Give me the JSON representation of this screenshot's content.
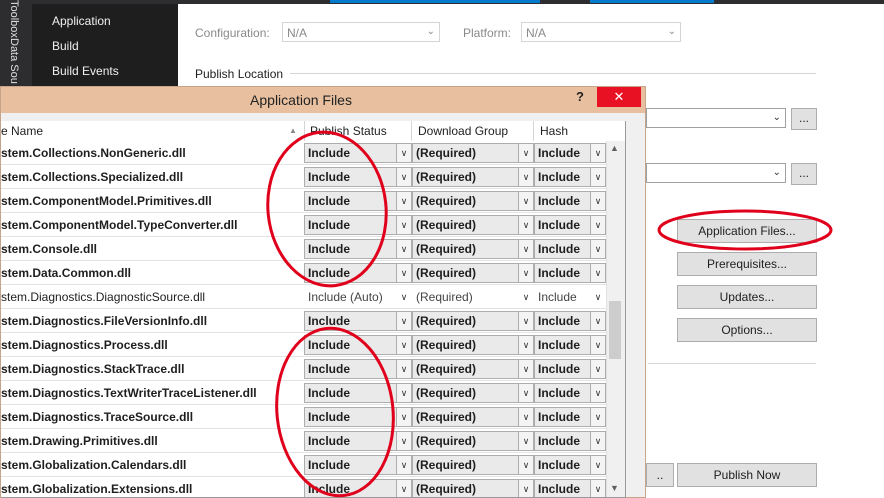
{
  "sidebar_tabs": [
    "Toolbox",
    "Data Sou"
  ],
  "project_nav": [
    "Application",
    "Build",
    "Build Events"
  ],
  "properties": {
    "configuration_label": "Configuration:",
    "configuration_value": "N/A",
    "platform_label": "Platform:",
    "platform_value": "N/A",
    "publish_location_label": "Publish Location",
    "browse_label": "...",
    "application_files_button": "Application Files...",
    "prerequisites_button": "Prerequisites...",
    "updates_button": "Updates...",
    "options_button": "Options...",
    "publish_now_button": "Publish Now"
  },
  "dialog": {
    "title": "Application Files",
    "help_label": "?",
    "close_label": "✕",
    "columns": [
      "e Name",
      "Publish Status",
      "Download Group",
      "Hash"
    ],
    "rows": [
      {
        "name": "stem.Collections.NonGeneric.dll",
        "status": "Include",
        "group": "(Required)",
        "hash": "Include",
        "auto": false
      },
      {
        "name": "stem.Collections.Specialized.dll",
        "status": "Include",
        "group": "(Required)",
        "hash": "Include",
        "auto": false
      },
      {
        "name": "stem.ComponentModel.Primitives.dll",
        "status": "Include",
        "group": "(Required)",
        "hash": "Include",
        "auto": false
      },
      {
        "name": "stem.ComponentModel.TypeConverter.dll",
        "status": "Include",
        "group": "(Required)",
        "hash": "Include",
        "auto": false
      },
      {
        "name": "stem.Console.dll",
        "status": "Include",
        "group": "(Required)",
        "hash": "Include",
        "auto": false
      },
      {
        "name": "stem.Data.Common.dll",
        "status": "Include",
        "group": "(Required)",
        "hash": "Include",
        "auto": false
      },
      {
        "name": "stem.Diagnostics.DiagnosticSource.dll",
        "status": "Include (Auto)",
        "group": "(Required)",
        "hash": "Include",
        "auto": true
      },
      {
        "name": "stem.Diagnostics.FileVersionInfo.dll",
        "status": "Include",
        "group": "(Required)",
        "hash": "Include",
        "auto": false
      },
      {
        "name": "stem.Diagnostics.Process.dll",
        "status": "Include",
        "group": "(Required)",
        "hash": "Include",
        "auto": false
      },
      {
        "name": "stem.Diagnostics.StackTrace.dll",
        "status": "Include",
        "group": "(Required)",
        "hash": "Include",
        "auto": false
      },
      {
        "name": "stem.Diagnostics.TextWriterTraceListener.dll",
        "status": "Include",
        "group": "(Required)",
        "hash": "Include",
        "auto": false
      },
      {
        "name": "stem.Diagnostics.TraceSource.dll",
        "status": "Include",
        "group": "(Required)",
        "hash": "Include",
        "auto": false
      },
      {
        "name": "stem.Drawing.Primitives.dll",
        "status": "Include",
        "group": "(Required)",
        "hash": "Include",
        "auto": false
      },
      {
        "name": "stem.Globalization.Calendars.dll",
        "status": "Include",
        "group": "(Required)",
        "hash": "Include",
        "auto": false
      },
      {
        "name": "stem.Globalization.Extensions.dll",
        "status": "Include",
        "group": "(Required)",
        "hash": "Include",
        "auto": false
      }
    ]
  },
  "colors": {
    "annotation_red": "#e0001b",
    "dialog_title_bg": "#e8c0a0",
    "close_button": "#e81123"
  },
  "icons": [
    "chevron-down-icon",
    "sort-up-icon",
    "scroll-up-icon",
    "scroll-down-icon",
    "close-icon",
    "help-icon"
  ]
}
